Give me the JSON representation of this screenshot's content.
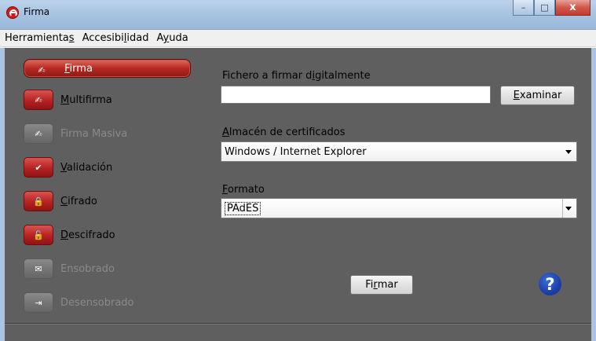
{
  "window": {
    "title": "Firma",
    "buttons": {
      "minimize": "–",
      "maximize": "□",
      "close": "x"
    }
  },
  "menu": {
    "items": [
      {
        "pre": "Herramienta",
        "key": "s",
        "post": ""
      },
      {
        "pre": "Accesibi",
        "key": "l",
        "post": "idad"
      },
      {
        "pre": "A",
        "key": "y",
        "post": "uda"
      }
    ]
  },
  "sidebar": {
    "items": [
      {
        "key": "F",
        "rest": "irma",
        "icon": "pen-people-icon",
        "enabled": true,
        "selected": true,
        "glyph": "✍"
      },
      {
        "key": "M",
        "rest": "ultifirma",
        "icon": "multi-people-icon",
        "enabled": true,
        "selected": false,
        "glyph": "✍"
      },
      {
        "key": "",
        "rest": "Firma Masiva",
        "icon": "batch-sign-icon",
        "enabled": false,
        "selected": false,
        "glyph": "✍"
      },
      {
        "key": "V",
        "rest": "alidación",
        "icon": "check-sign-icon",
        "enabled": true,
        "selected": false,
        "glyph": "✔"
      },
      {
        "key": "C",
        "rest": "ifrado",
        "icon": "lock-binary-icon",
        "enabled": true,
        "selected": false,
        "glyph": "🔒"
      },
      {
        "key": "D",
        "rest": "escifrado",
        "icon": "unlock-binary-icon",
        "enabled": true,
        "selected": false,
        "glyph": "🔓"
      },
      {
        "key": "",
        "rest": "Ensobrado",
        "icon": "envelope-icon",
        "enabled": false,
        "selected": false,
        "glyph": "✉"
      },
      {
        "key": "",
        "rest": "Desensobrado",
        "icon": "open-envelope-icon",
        "enabled": false,
        "selected": false,
        "glyph": "⇥"
      }
    ]
  },
  "form": {
    "file_label": {
      "pre": "Fichero a firmar d",
      "key": "i",
      "post": "gitalmente"
    },
    "file_value": "",
    "browse_button": {
      "pre": "",
      "key": "E",
      "post": "xaminar"
    },
    "store_label": {
      "pre": "",
      "key": "A",
      "post": "lmacén de certificados"
    },
    "store_value": "Windows / Internet Explorer",
    "format_label": {
      "pre": "",
      "key": "F",
      "post": "ormato"
    },
    "format_value": "PAdES",
    "sign_button": {
      "pre": "Fi",
      "key": "r",
      "post": "mar"
    }
  },
  "help": {
    "glyph": "?"
  },
  "colors": {
    "panel": "#5f5f5f",
    "accent_red": "#b52222",
    "disabled_text": "#8a8a8a",
    "help_blue": "#1b3fa8"
  }
}
